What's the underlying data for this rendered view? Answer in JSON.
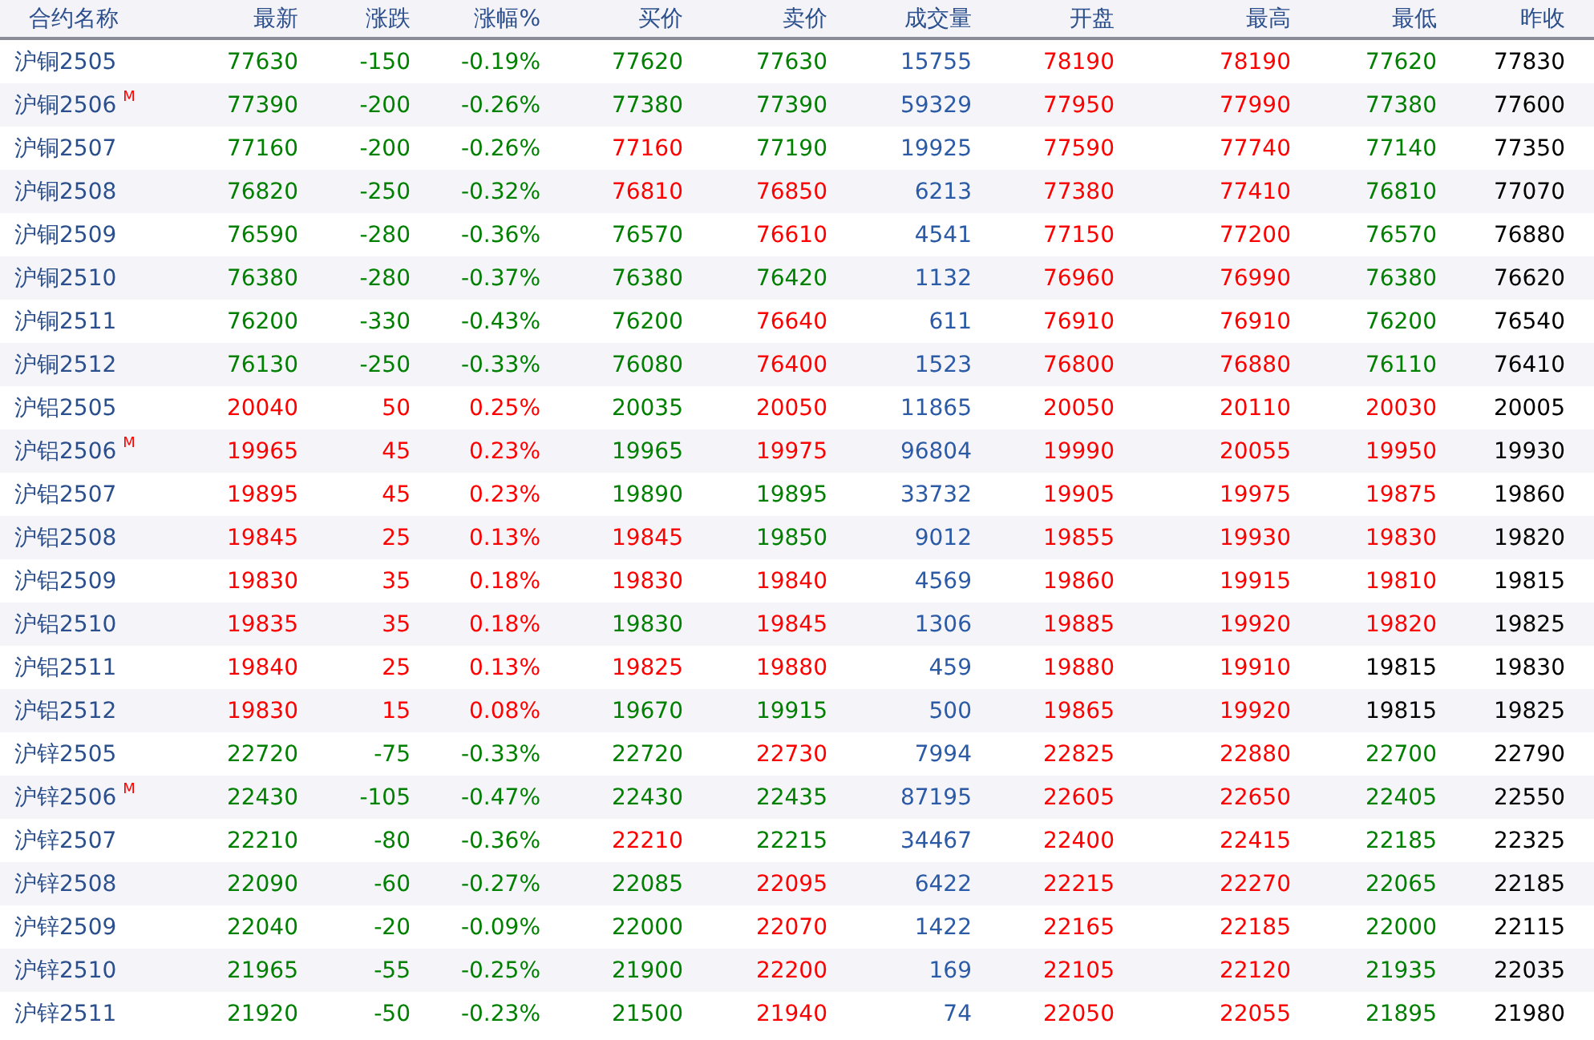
{
  "columns": [
    "合约名称",
    "最新",
    "涨跌",
    "涨幅%",
    "买价",
    "卖价",
    "成交量",
    "开盘",
    "最高",
    "最低",
    "昨收"
  ],
  "rows": [
    {
      "name": "沪铜2505",
      "cells": [
        {
          "text": "77630",
          "color": "#008000"
        },
        {
          "text": "-150",
          "color": "#008000"
        },
        {
          "text": "-0.19%",
          "color": "#008000"
        },
        {
          "text": "77620",
          "color": "#008000"
        },
        {
          "text": "77630",
          "color": "#008000"
        },
        {
          "text": "15755",
          "color": "#2b5aa6"
        },
        {
          "text": "78190",
          "color": "#ff0000"
        },
        {
          "text": "78190",
          "color": "#ff0000"
        },
        {
          "text": "77620",
          "color": "#008000"
        },
        {
          "text": "77830",
          "color": "#000000"
        }
      ]
    },
    {
      "name": "沪铜2506",
      "badge": "M",
      "cells": [
        {
          "text": "77390",
          "color": "#008000"
        },
        {
          "text": "-200",
          "color": "#008000"
        },
        {
          "text": "-0.26%",
          "color": "#008000"
        },
        {
          "text": "77380",
          "color": "#008000"
        },
        {
          "text": "77390",
          "color": "#008000"
        },
        {
          "text": "59329",
          "color": "#2b5aa6"
        },
        {
          "text": "77950",
          "color": "#ff0000"
        },
        {
          "text": "77990",
          "color": "#ff0000"
        },
        {
          "text": "77380",
          "color": "#008000"
        },
        {
          "text": "77600",
          "color": "#000000"
        }
      ]
    },
    {
      "name": "沪铜2507",
      "cells": [
        {
          "text": "77160",
          "color": "#008000"
        },
        {
          "text": "-200",
          "color": "#008000"
        },
        {
          "text": "-0.26%",
          "color": "#008000"
        },
        {
          "text": "77160",
          "color": "#ff0000"
        },
        {
          "text": "77190",
          "color": "#008000"
        },
        {
          "text": "19925",
          "color": "#2b5aa6"
        },
        {
          "text": "77590",
          "color": "#ff0000"
        },
        {
          "text": "77740",
          "color": "#ff0000"
        },
        {
          "text": "77140",
          "color": "#008000"
        },
        {
          "text": "77350",
          "color": "#000000"
        }
      ]
    },
    {
      "name": "沪铜2508",
      "cells": [
        {
          "text": "76820",
          "color": "#008000"
        },
        {
          "text": "-250",
          "color": "#008000"
        },
        {
          "text": "-0.32%",
          "color": "#008000"
        },
        {
          "text": "76810",
          "color": "#ff0000"
        },
        {
          "text": "76850",
          "color": "#ff0000"
        },
        {
          "text": "6213",
          "color": "#2b5aa6"
        },
        {
          "text": "77380",
          "color": "#ff0000"
        },
        {
          "text": "77410",
          "color": "#ff0000"
        },
        {
          "text": "76810",
          "color": "#008000"
        },
        {
          "text": "77070",
          "color": "#000000"
        }
      ]
    },
    {
      "name": "沪铜2509",
      "cells": [
        {
          "text": "76590",
          "color": "#008000"
        },
        {
          "text": "-280",
          "color": "#008000"
        },
        {
          "text": "-0.36%",
          "color": "#008000"
        },
        {
          "text": "76570",
          "color": "#008000"
        },
        {
          "text": "76610",
          "color": "#ff0000"
        },
        {
          "text": "4541",
          "color": "#2b5aa6"
        },
        {
          "text": "77150",
          "color": "#ff0000"
        },
        {
          "text": "77200",
          "color": "#ff0000"
        },
        {
          "text": "76570",
          "color": "#008000"
        },
        {
          "text": "76880",
          "color": "#000000"
        }
      ]
    },
    {
      "name": "沪铜2510",
      "cells": [
        {
          "text": "76380",
          "color": "#008000"
        },
        {
          "text": "-280",
          "color": "#008000"
        },
        {
          "text": "-0.37%",
          "color": "#008000"
        },
        {
          "text": "76380",
          "color": "#008000"
        },
        {
          "text": "76420",
          "color": "#008000"
        },
        {
          "text": "1132",
          "color": "#2b5aa6"
        },
        {
          "text": "76960",
          "color": "#ff0000"
        },
        {
          "text": "76990",
          "color": "#ff0000"
        },
        {
          "text": "76380",
          "color": "#008000"
        },
        {
          "text": "76620",
          "color": "#000000"
        }
      ]
    },
    {
      "name": "沪铜2511",
      "cells": [
        {
          "text": "76200",
          "color": "#008000"
        },
        {
          "text": "-330",
          "color": "#008000"
        },
        {
          "text": "-0.43%",
          "color": "#008000"
        },
        {
          "text": "76200",
          "color": "#008000"
        },
        {
          "text": "76640",
          "color": "#ff0000"
        },
        {
          "text": "611",
          "color": "#2b5aa6"
        },
        {
          "text": "76910",
          "color": "#ff0000"
        },
        {
          "text": "76910",
          "color": "#ff0000"
        },
        {
          "text": "76200",
          "color": "#008000"
        },
        {
          "text": "76540",
          "color": "#000000"
        }
      ]
    },
    {
      "name": "沪铜2512",
      "cells": [
        {
          "text": "76130",
          "color": "#008000"
        },
        {
          "text": "-250",
          "color": "#008000"
        },
        {
          "text": "-0.33%",
          "color": "#008000"
        },
        {
          "text": "76080",
          "color": "#008000"
        },
        {
          "text": "76400",
          "color": "#ff0000"
        },
        {
          "text": "1523",
          "color": "#2b5aa6"
        },
        {
          "text": "76800",
          "color": "#ff0000"
        },
        {
          "text": "76880",
          "color": "#ff0000"
        },
        {
          "text": "76110",
          "color": "#008000"
        },
        {
          "text": "76410",
          "color": "#000000"
        }
      ]
    },
    {
      "name": "沪铝2505",
      "cells": [
        {
          "text": "20040",
          "color": "#ff0000"
        },
        {
          "text": "50",
          "color": "#ff0000"
        },
        {
          "text": "0.25%",
          "color": "#ff0000"
        },
        {
          "text": "20035",
          "color": "#008000"
        },
        {
          "text": "20050",
          "color": "#ff0000"
        },
        {
          "text": "11865",
          "color": "#2b5aa6"
        },
        {
          "text": "20050",
          "color": "#ff0000"
        },
        {
          "text": "20110",
          "color": "#ff0000"
        },
        {
          "text": "20030",
          "color": "#ff0000"
        },
        {
          "text": "20005",
          "color": "#000000"
        }
      ]
    },
    {
      "name": "沪铝2506",
      "badge": "M",
      "cells": [
        {
          "text": "19965",
          "color": "#ff0000"
        },
        {
          "text": "45",
          "color": "#ff0000"
        },
        {
          "text": "0.23%",
          "color": "#ff0000"
        },
        {
          "text": "19965",
          "color": "#008000"
        },
        {
          "text": "19975",
          "color": "#ff0000"
        },
        {
          "text": "96804",
          "color": "#2b5aa6"
        },
        {
          "text": "19990",
          "color": "#ff0000"
        },
        {
          "text": "20055",
          "color": "#ff0000"
        },
        {
          "text": "19950",
          "color": "#ff0000"
        },
        {
          "text": "19930",
          "color": "#000000"
        }
      ]
    },
    {
      "name": "沪铝2507",
      "cells": [
        {
          "text": "19895",
          "color": "#ff0000"
        },
        {
          "text": "45",
          "color": "#ff0000"
        },
        {
          "text": "0.23%",
          "color": "#ff0000"
        },
        {
          "text": "19890",
          "color": "#008000"
        },
        {
          "text": "19895",
          "color": "#008000"
        },
        {
          "text": "33732",
          "color": "#2b5aa6"
        },
        {
          "text": "19905",
          "color": "#ff0000"
        },
        {
          "text": "19975",
          "color": "#ff0000"
        },
        {
          "text": "19875",
          "color": "#ff0000"
        },
        {
          "text": "19860",
          "color": "#000000"
        }
      ]
    },
    {
      "name": "沪铝2508",
      "cells": [
        {
          "text": "19845",
          "color": "#ff0000"
        },
        {
          "text": "25",
          "color": "#ff0000"
        },
        {
          "text": "0.13%",
          "color": "#ff0000"
        },
        {
          "text": "19845",
          "color": "#ff0000"
        },
        {
          "text": "19850",
          "color": "#008000"
        },
        {
          "text": "9012",
          "color": "#2b5aa6"
        },
        {
          "text": "19855",
          "color": "#ff0000"
        },
        {
          "text": "19930",
          "color": "#ff0000"
        },
        {
          "text": "19830",
          "color": "#ff0000"
        },
        {
          "text": "19820",
          "color": "#000000"
        }
      ]
    },
    {
      "name": "沪铝2509",
      "cells": [
        {
          "text": "19830",
          "color": "#ff0000"
        },
        {
          "text": "35",
          "color": "#ff0000"
        },
        {
          "text": "0.18%",
          "color": "#ff0000"
        },
        {
          "text": "19830",
          "color": "#ff0000"
        },
        {
          "text": "19840",
          "color": "#ff0000"
        },
        {
          "text": "4569",
          "color": "#2b5aa6"
        },
        {
          "text": "19860",
          "color": "#ff0000"
        },
        {
          "text": "19915",
          "color": "#ff0000"
        },
        {
          "text": "19810",
          "color": "#ff0000"
        },
        {
          "text": "19815",
          "color": "#000000"
        }
      ]
    },
    {
      "name": "沪铝2510",
      "cells": [
        {
          "text": "19835",
          "color": "#ff0000"
        },
        {
          "text": "35",
          "color": "#ff0000"
        },
        {
          "text": "0.18%",
          "color": "#ff0000"
        },
        {
          "text": "19830",
          "color": "#008000"
        },
        {
          "text": "19845",
          "color": "#ff0000"
        },
        {
          "text": "1306",
          "color": "#2b5aa6"
        },
        {
          "text": "19885",
          "color": "#ff0000"
        },
        {
          "text": "19920",
          "color": "#ff0000"
        },
        {
          "text": "19820",
          "color": "#ff0000"
        },
        {
          "text": "19825",
          "color": "#000000"
        }
      ]
    },
    {
      "name": "沪铝2511",
      "cells": [
        {
          "text": "19840",
          "color": "#ff0000"
        },
        {
          "text": "25",
          "color": "#ff0000"
        },
        {
          "text": "0.13%",
          "color": "#ff0000"
        },
        {
          "text": "19825",
          "color": "#ff0000"
        },
        {
          "text": "19880",
          "color": "#ff0000"
        },
        {
          "text": "459",
          "color": "#2b5aa6"
        },
        {
          "text": "19880",
          "color": "#ff0000"
        },
        {
          "text": "19910",
          "color": "#ff0000"
        },
        {
          "text": "19815",
          "color": "#000000"
        },
        {
          "text": "19830",
          "color": "#000000"
        }
      ]
    },
    {
      "name": "沪铝2512",
      "cells": [
        {
          "text": "19830",
          "color": "#ff0000"
        },
        {
          "text": "15",
          "color": "#ff0000"
        },
        {
          "text": "0.08%",
          "color": "#ff0000"
        },
        {
          "text": "19670",
          "color": "#008000"
        },
        {
          "text": "19915",
          "color": "#008000"
        },
        {
          "text": "500",
          "color": "#2b5aa6"
        },
        {
          "text": "19865",
          "color": "#ff0000"
        },
        {
          "text": "19920",
          "color": "#ff0000"
        },
        {
          "text": "19815",
          "color": "#000000"
        },
        {
          "text": "19825",
          "color": "#000000"
        }
      ]
    },
    {
      "name": "沪锌2505",
      "cells": [
        {
          "text": "22720",
          "color": "#008000"
        },
        {
          "text": "-75",
          "color": "#008000"
        },
        {
          "text": "-0.33%",
          "color": "#008000"
        },
        {
          "text": "22720",
          "color": "#008000"
        },
        {
          "text": "22730",
          "color": "#ff0000"
        },
        {
          "text": "7994",
          "color": "#2b5aa6"
        },
        {
          "text": "22825",
          "color": "#ff0000"
        },
        {
          "text": "22880",
          "color": "#ff0000"
        },
        {
          "text": "22700",
          "color": "#008000"
        },
        {
          "text": "22790",
          "color": "#000000"
        }
      ]
    },
    {
      "name": "沪锌2506",
      "badge": "M",
      "cells": [
        {
          "text": "22430",
          "color": "#008000"
        },
        {
          "text": "-105",
          "color": "#008000"
        },
        {
          "text": "-0.47%",
          "color": "#008000"
        },
        {
          "text": "22430",
          "color": "#008000"
        },
        {
          "text": "22435",
          "color": "#008000"
        },
        {
          "text": "87195",
          "color": "#2b5aa6"
        },
        {
          "text": "22605",
          "color": "#ff0000"
        },
        {
          "text": "22650",
          "color": "#ff0000"
        },
        {
          "text": "22405",
          "color": "#008000"
        },
        {
          "text": "22550",
          "color": "#000000"
        }
      ]
    },
    {
      "name": "沪锌2507",
      "cells": [
        {
          "text": "22210",
          "color": "#008000"
        },
        {
          "text": "-80",
          "color": "#008000"
        },
        {
          "text": "-0.36%",
          "color": "#008000"
        },
        {
          "text": "22210",
          "color": "#ff0000"
        },
        {
          "text": "22215",
          "color": "#008000"
        },
        {
          "text": "34467",
          "color": "#2b5aa6"
        },
        {
          "text": "22400",
          "color": "#ff0000"
        },
        {
          "text": "22415",
          "color": "#ff0000"
        },
        {
          "text": "22185",
          "color": "#008000"
        },
        {
          "text": "22325",
          "color": "#000000"
        }
      ]
    },
    {
      "name": "沪锌2508",
      "cells": [
        {
          "text": "22090",
          "color": "#008000"
        },
        {
          "text": "-60",
          "color": "#008000"
        },
        {
          "text": "-0.27%",
          "color": "#008000"
        },
        {
          "text": "22085",
          "color": "#008000"
        },
        {
          "text": "22095",
          "color": "#ff0000"
        },
        {
          "text": "6422",
          "color": "#2b5aa6"
        },
        {
          "text": "22215",
          "color": "#ff0000"
        },
        {
          "text": "22270",
          "color": "#ff0000"
        },
        {
          "text": "22065",
          "color": "#008000"
        },
        {
          "text": "22185",
          "color": "#000000"
        }
      ]
    },
    {
      "name": "沪锌2509",
      "cells": [
        {
          "text": "22040",
          "color": "#008000"
        },
        {
          "text": "-20",
          "color": "#008000"
        },
        {
          "text": "-0.09%",
          "color": "#008000"
        },
        {
          "text": "22000",
          "color": "#008000"
        },
        {
          "text": "22070",
          "color": "#ff0000"
        },
        {
          "text": "1422",
          "color": "#2b5aa6"
        },
        {
          "text": "22165",
          "color": "#ff0000"
        },
        {
          "text": "22185",
          "color": "#ff0000"
        },
        {
          "text": "22000",
          "color": "#008000"
        },
        {
          "text": "22115",
          "color": "#000000"
        }
      ]
    },
    {
      "name": "沪锌2510",
      "cells": [
        {
          "text": "21965",
          "color": "#008000"
        },
        {
          "text": "-55",
          "color": "#008000"
        },
        {
          "text": "-0.25%",
          "color": "#008000"
        },
        {
          "text": "21900",
          "color": "#008000"
        },
        {
          "text": "22200",
          "color": "#ff0000"
        },
        {
          "text": "169",
          "color": "#2b5aa6"
        },
        {
          "text": "22105",
          "color": "#ff0000"
        },
        {
          "text": "22120",
          "color": "#ff0000"
        },
        {
          "text": "21935",
          "color": "#008000"
        },
        {
          "text": "22035",
          "color": "#000000"
        }
      ]
    },
    {
      "name": "沪锌2511",
      "cells": [
        {
          "text": "21920",
          "color": "#008000"
        },
        {
          "text": "-50",
          "color": "#008000"
        },
        {
          "text": "-0.23%",
          "color": "#008000"
        },
        {
          "text": "21500",
          "color": "#008000"
        },
        {
          "text": "21940",
          "color": "#ff0000"
        },
        {
          "text": "74",
          "color": "#2b5aa6"
        },
        {
          "text": "22050",
          "color": "#ff0000"
        },
        {
          "text": "22055",
          "color": "#ff0000"
        },
        {
          "text": "21895",
          "color": "#008000"
        },
        {
          "text": "21980",
          "color": "#000000"
        }
      ]
    }
  ]
}
